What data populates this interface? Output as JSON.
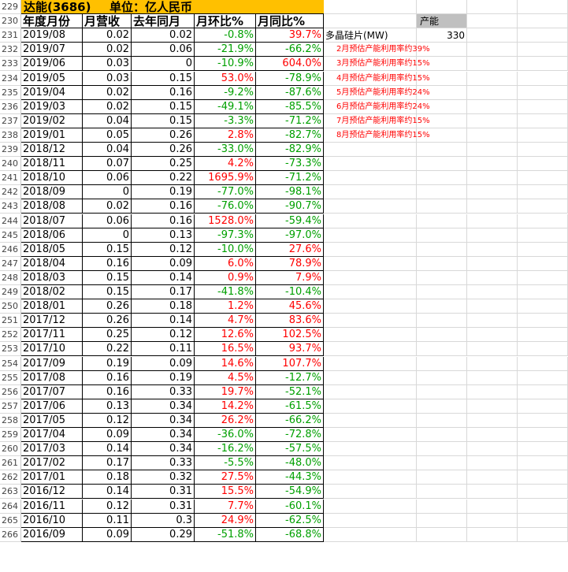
{
  "title": {
    "company": "达能(3686)",
    "unit": "单位：亿人民币",
    "row_number": "229"
  },
  "header": {
    "row_number": "230",
    "columns": [
      "年度月份",
      "月营收",
      "去年同月",
      "月环比%",
      "月同比%"
    ]
  },
  "side_panel": {
    "capacity_label": "产能",
    "wafer_label": "多晶硅片(MW)",
    "wafer_value": "330",
    "notes": [
      "2月预估产能利用率约39%",
      "3月预估产能利用率约15%",
      "4月预估产能利用率约15%",
      "5月预估产能利用率约24%",
      "6月预估产能利用率约24%",
      "7月预估产能利用率约15%",
      "8月预估产能利用率约15%"
    ]
  },
  "colors": {
    "header_bg": "#ffc000",
    "positive": "#ff0000",
    "negative": "#00a000",
    "capacity_bg": "#c0c0c0"
  },
  "rows": [
    {
      "n": "231",
      "month": "2019/08",
      "rev": "0.02",
      "prev": "0.02",
      "mom": "-0.8%",
      "yoy": "39.7%"
    },
    {
      "n": "232",
      "month": "2019/07",
      "rev": "0.02",
      "prev": "0.06",
      "mom": "-21.9%",
      "yoy": "-66.2%"
    },
    {
      "n": "233",
      "month": "2019/06",
      "rev": "0.03",
      "prev": "0",
      "mom": "-10.9%",
      "yoy": "604.0%"
    },
    {
      "n": "234",
      "month": "2019/05",
      "rev": "0.03",
      "prev": "0.15",
      "mom": "53.0%",
      "yoy": "-78.9%"
    },
    {
      "n": "235",
      "month": "2019/04",
      "rev": "0.02",
      "prev": "0.16",
      "mom": "-9.2%",
      "yoy": "-87.6%"
    },
    {
      "n": "236",
      "month": "2019/03",
      "rev": "0.02",
      "prev": "0.15",
      "mom": "-49.1%",
      "yoy": "-85.5%"
    },
    {
      "n": "237",
      "month": "2019/02",
      "rev": "0.04",
      "prev": "0.15",
      "mom": "-3.3%",
      "yoy": "-71.2%"
    },
    {
      "n": "238",
      "month": "2019/01",
      "rev": "0.05",
      "prev": "0.26",
      "mom": "2.8%",
      "yoy": "-82.7%"
    },
    {
      "n": "239",
      "month": "2018/12",
      "rev": "0.04",
      "prev": "0.26",
      "mom": "-33.0%",
      "yoy": "-82.9%"
    },
    {
      "n": "240",
      "month": "2018/11",
      "rev": "0.07",
      "prev": "0.25",
      "mom": "4.2%",
      "yoy": "-73.3%"
    },
    {
      "n": "241",
      "month": "2018/10",
      "rev": "0.06",
      "prev": "0.22",
      "mom": "1695.9%",
      "yoy": "-71.2%"
    },
    {
      "n": "242",
      "month": "2018/09",
      "rev": "0",
      "prev": "0.19",
      "mom": "-77.0%",
      "yoy": "-98.1%"
    },
    {
      "n": "243",
      "month": "2018/08",
      "rev": "0.02",
      "prev": "0.16",
      "mom": "-76.0%",
      "yoy": "-90.7%"
    },
    {
      "n": "244",
      "month": "2018/07",
      "rev": "0.06",
      "prev": "0.16",
      "mom": "1528.0%",
      "yoy": "-59.4%"
    },
    {
      "n": "245",
      "month": "2018/06",
      "rev": "0",
      "prev": "0.13",
      "mom": "-97.3%",
      "yoy": "-97.0%"
    },
    {
      "n": "246",
      "month": "2018/05",
      "rev": "0.15",
      "prev": "0.12",
      "mom": "-10.0%",
      "yoy": "27.6%"
    },
    {
      "n": "247",
      "month": "2018/04",
      "rev": "0.16",
      "prev": "0.09",
      "mom": "6.0%",
      "yoy": "78.9%"
    },
    {
      "n": "248",
      "month": "2018/03",
      "rev": "0.15",
      "prev": "0.14",
      "mom": "0.9%",
      "yoy": "7.9%"
    },
    {
      "n": "249",
      "month": "2018/02",
      "rev": "0.15",
      "prev": "0.17",
      "mom": "-41.8%",
      "yoy": "-10.4%"
    },
    {
      "n": "250",
      "month": "2018/01",
      "rev": "0.26",
      "prev": "0.18",
      "mom": "1.2%",
      "yoy": "45.6%"
    },
    {
      "n": "251",
      "month": "2017/12",
      "rev": "0.26",
      "prev": "0.14",
      "mom": "4.7%",
      "yoy": "83.6%"
    },
    {
      "n": "252",
      "month": "2017/11",
      "rev": "0.25",
      "prev": "0.12",
      "mom": "12.6%",
      "yoy": "102.5%"
    },
    {
      "n": "253",
      "month": "2017/10",
      "rev": "0.22",
      "prev": "0.11",
      "mom": "16.5%",
      "yoy": "93.7%"
    },
    {
      "n": "254",
      "month": "2017/09",
      "rev": "0.19",
      "prev": "0.09",
      "mom": "14.6%",
      "yoy": "107.7%"
    },
    {
      "n": "255",
      "month": "2017/08",
      "rev": "0.16",
      "prev": "0.19",
      "mom": "4.5%",
      "yoy": "-12.7%"
    },
    {
      "n": "256",
      "month": "2017/07",
      "rev": "0.16",
      "prev": "0.33",
      "mom": "19.7%",
      "yoy": "-52.1%"
    },
    {
      "n": "257",
      "month": "2017/06",
      "rev": "0.13",
      "prev": "0.34",
      "mom": "14.2%",
      "yoy": "-61.5%"
    },
    {
      "n": "258",
      "month": "2017/05",
      "rev": "0.12",
      "prev": "0.34",
      "mom": "26.2%",
      "yoy": "-66.2%"
    },
    {
      "n": "259",
      "month": "2017/04",
      "rev": "0.09",
      "prev": "0.34",
      "mom": "-36.0%",
      "yoy": "-72.8%"
    },
    {
      "n": "260",
      "month": "2017/03",
      "rev": "0.14",
      "prev": "0.34",
      "mom": "-16.2%",
      "yoy": "-57.5%"
    },
    {
      "n": "261",
      "month": "2017/02",
      "rev": "0.17",
      "prev": "0.33",
      "mom": "-5.5%",
      "yoy": "-48.0%"
    },
    {
      "n": "262",
      "month": "2017/01",
      "rev": "0.18",
      "prev": "0.32",
      "mom": "27.5%",
      "yoy": "-44.3%"
    },
    {
      "n": "263",
      "month": "2016/12",
      "rev": "0.14",
      "prev": "0.31",
      "mom": "15.5%",
      "yoy": "-54.9%"
    },
    {
      "n": "264",
      "month": "2016/11",
      "rev": "0.12",
      "prev": "0.31",
      "mom": "7.7%",
      "yoy": "-60.1%"
    },
    {
      "n": "265",
      "month": "2016/10",
      "rev": "0.11",
      "prev": "0.3",
      "mom": "24.9%",
      "yoy": "-62.5%"
    },
    {
      "n": "266",
      "month": "2016/09",
      "rev": "0.09",
      "prev": "0.29",
      "mom": "-51.8%",
      "yoy": "-68.8%"
    }
  ]
}
